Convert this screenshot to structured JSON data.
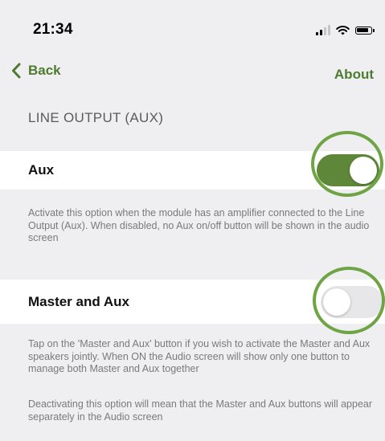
{
  "status_bar": {
    "time": "21:34",
    "icons": [
      "cellular-signal-icon",
      "wifi-icon",
      "battery-icon"
    ]
  },
  "nav": {
    "back_label": "Back",
    "about_label": "About"
  },
  "section": {
    "title": "LINE OUTPUT (AUX)"
  },
  "settings": [
    {
      "label": "Aux",
      "enabled": true,
      "description": "Activate this option when the module has an amplifier connected to the Line Output (Aux). When disabled, no Aux on/off button will be shown in the audio screen"
    },
    {
      "label": "Master and Aux",
      "enabled": false,
      "description": "Tap on the 'Master and Aux' button if you wish to activate the Master and Aux speakers jointly. When ON the Audio screen will show only one button to manage both Master and Aux together",
      "description_extra": "Deactivating this option will mean that the Master and Aux buttons will appear separately in the Audio screen"
    }
  ],
  "colors": {
    "accent": "#4d7b2f",
    "toggle_on": "#5f8739",
    "toggle_off": "#e7e7e9",
    "highlight_ring": "#6ea443",
    "background": "#efeff2"
  }
}
